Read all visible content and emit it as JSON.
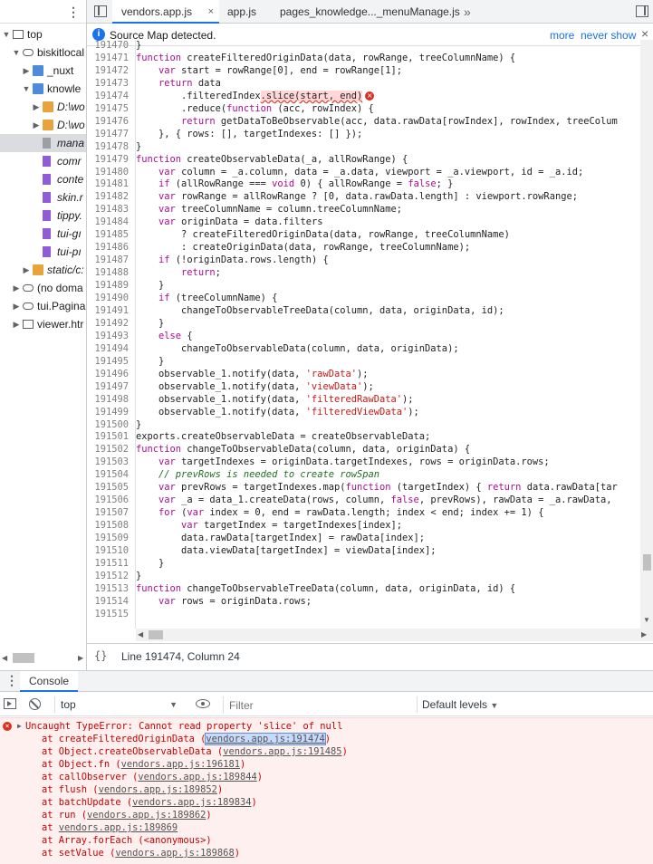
{
  "sidebar": {
    "tree": [
      {
        "label": "top",
        "icon": "page-frame-icon",
        "depth": 0,
        "expanded": true
      },
      {
        "label": "biskitlocal",
        "icon": "cloud-icon",
        "depth": 1,
        "expanded": true
      },
      {
        "label": "_nuxt",
        "icon": "folder-icon",
        "depth": 2,
        "expanded": false
      },
      {
        "label": "knowle",
        "icon": "folder-icon",
        "depth": 2,
        "expanded": true
      },
      {
        "label": "D:\\wo",
        "icon": "folder-orange-icon",
        "depth": 3,
        "expanded": false,
        "italic": true
      },
      {
        "label": "D:\\wo",
        "icon": "folder-orange-icon",
        "depth": 3,
        "expanded": false,
        "italic": true
      },
      {
        "label": "mana",
        "icon": "file-grey-icon",
        "depth": 3,
        "selected": true,
        "italic": true
      },
      {
        "label": "comr",
        "icon": "file-purple-icon",
        "depth": 3,
        "italic": true
      },
      {
        "label": "conte",
        "icon": "file-purple-icon",
        "depth": 3,
        "italic": true
      },
      {
        "label": "skin.r",
        "icon": "file-purple-icon",
        "depth": 3,
        "italic": true
      },
      {
        "label": "tippy.",
        "icon": "file-purple-icon",
        "depth": 3,
        "italic": true
      },
      {
        "label": "tui-gı",
        "icon": "file-purple-icon",
        "depth": 3,
        "italic": true
      },
      {
        "label": "tui-pı",
        "icon": "file-purple-icon",
        "depth": 3,
        "italic": true
      },
      {
        "label": "static/c:",
        "icon": "folder-orange-icon",
        "depth": 2,
        "expanded": false,
        "italic": true
      },
      {
        "label": "(no doma",
        "icon": "cloud-icon",
        "depth": 1,
        "expanded": false
      },
      {
        "label": "tui.Pagina",
        "icon": "cloud-icon",
        "depth": 1,
        "expanded": false
      },
      {
        "label": "viewer.htr",
        "icon": "page-frame-icon",
        "depth": 1,
        "expanded": false
      }
    ]
  },
  "tabs": [
    {
      "label": "vendors.app.js",
      "active": true,
      "closable": true
    },
    {
      "label": "app.js",
      "active": false
    },
    {
      "label": "pages_knowledge..._menuManage.js",
      "active": false
    }
  ],
  "tabs_more": "»",
  "infobar": {
    "text": "Source Map detected.",
    "more": "more",
    "never_show": "never show"
  },
  "code": [
    {
      "n": "191470",
      "t": "}"
    },
    {
      "n": "191471",
      "t": "function createFilteredOriginData(data, rowRange, treeColumnName) {"
    },
    {
      "n": "191472",
      "t": "    var start = rowRange[0], end = rowRange[1];"
    },
    {
      "n": "191473",
      "t": "    return data"
    },
    {
      "n": "191474",
      "t": "        .filteredIndex.slice(start, end)",
      "err": true
    },
    {
      "n": "191475",
      "t": "        .reduce(function (acc, rowIndex) {"
    },
    {
      "n": "191476",
      "t": "        return getDataToBeObservable(acc, data.rawData[rowIndex], rowIndex, treeColum"
    },
    {
      "n": "191477",
      "t": "    }, { rows: [], targetIndexes: [] });"
    },
    {
      "n": "191478",
      "t": "}"
    },
    {
      "n": "191479",
      "t": "function createObservableData(_a, allRowRange) {"
    },
    {
      "n": "191480",
      "t": "    var column = _a.column, data = _a.data, viewport = _a.viewport, id = _a.id;"
    },
    {
      "n": "191481",
      "t": "    if (allRowRange === void 0) { allRowRange = false; }"
    },
    {
      "n": "191482",
      "t": "    var rowRange = allRowRange ? [0, data.rawData.length] : viewport.rowRange;"
    },
    {
      "n": "191483",
      "t": "    var treeColumnName = column.treeColumnName;"
    },
    {
      "n": "191484",
      "t": "    var originData = data.filters"
    },
    {
      "n": "191485",
      "t": "        ? createFilteredOriginData(data, rowRange, treeColumnName)"
    },
    {
      "n": "191486",
      "t": "        : createOriginData(data, rowRange, treeColumnName);"
    },
    {
      "n": "191487",
      "t": "    if (!originData.rows.length) {"
    },
    {
      "n": "191488",
      "t": "        return;"
    },
    {
      "n": "191489",
      "t": "    }"
    },
    {
      "n": "191490",
      "t": "    if (treeColumnName) {"
    },
    {
      "n": "191491",
      "t": "        changeToObservableTreeData(column, data, originData, id);"
    },
    {
      "n": "191492",
      "t": "    }"
    },
    {
      "n": "191493",
      "t": "    else {"
    },
    {
      "n": "191494",
      "t": "        changeToObservableData(column, data, originData);"
    },
    {
      "n": "191495",
      "t": "    }"
    },
    {
      "n": "191496",
      "t": "    observable_1.notify(data, 'rawData');"
    },
    {
      "n": "191497",
      "t": "    observable_1.notify(data, 'viewData');"
    },
    {
      "n": "191498",
      "t": "    observable_1.notify(data, 'filteredRawData');"
    },
    {
      "n": "191499",
      "t": "    observable_1.notify(data, 'filteredViewData');"
    },
    {
      "n": "191500",
      "t": "}"
    },
    {
      "n": "191501",
      "t": "exports.createObservableData = createObservableData;"
    },
    {
      "n": "191502",
      "t": "function changeToObservableData(column, data, originData) {"
    },
    {
      "n": "191503",
      "t": "    var targetIndexes = originData.targetIndexes, rows = originData.rows;"
    },
    {
      "n": "191504",
      "t": "    // prevRows is needed to create rowSpan",
      "comment": true
    },
    {
      "n": "191505",
      "t": "    var prevRows = targetIndexes.map(function (targetIndex) { return data.rawData[tar"
    },
    {
      "n": "191506",
      "t": "    var _a = data_1.createData(rows, column, false, prevRows), rawData = _a.rawData,"
    },
    {
      "n": "191507",
      "t": "    for (var index = 0, end = rawData.length; index < end; index += 1) {"
    },
    {
      "n": "191508",
      "t": "        var targetIndex = targetIndexes[index];"
    },
    {
      "n": "191509",
      "t": "        data.rawData[targetIndex] = rawData[index];"
    },
    {
      "n": "191510",
      "t": "        data.viewData[targetIndex] = viewData[index];"
    },
    {
      "n": "191511",
      "t": "    }"
    },
    {
      "n": "191512",
      "t": "}"
    },
    {
      "n": "191513",
      "t": "function changeToObservableTreeData(column, data, originData, id) {"
    },
    {
      "n": "191514",
      "t": "    var rows = originData.rows;"
    },
    {
      "n": "191515",
      "t": ""
    }
  ],
  "status": {
    "braces": "{}",
    "position": "Line 191474, Column 24"
  },
  "drawer": {
    "tab": "Console",
    "menu_icon": "kebab-menu-icon"
  },
  "console_toolbar": {
    "context": "top",
    "filter_placeholder": "Filter",
    "levels": "Default levels"
  },
  "error": {
    "message": "Uncaught TypeError: Cannot read property 'slice' of null",
    "stack": [
      {
        "pre": "at createFilteredOriginData (",
        "link": "vendors.app.js:191474",
        "post": ")",
        "highlight": true
      },
      {
        "pre": "at Object.createObservableData (",
        "link": "vendors.app.js:191485",
        "post": ")"
      },
      {
        "pre": "at Object.fn (",
        "link": "vendors.app.js:196181",
        "post": ")"
      },
      {
        "pre": "at callObserver (",
        "link": "vendors.app.js:189844",
        "post": ")"
      },
      {
        "pre": "at flush (",
        "link": "vendors.app.js:189852",
        "post": ")"
      },
      {
        "pre": "at batchUpdate (",
        "link": "vendors.app.js:189834",
        "post": ")"
      },
      {
        "pre": "at run (",
        "link": "vendors.app.js:189862",
        "post": ")"
      },
      {
        "pre": "at ",
        "link": "vendors.app.js:189869",
        "post": ""
      },
      {
        "pre": "at Array.forEach (<anonymous>)",
        "link": "",
        "post": ""
      },
      {
        "pre": "at setValue (",
        "link": "vendors.app.js:189868",
        "post": ")"
      }
    ]
  },
  "colors": {
    "accent": "#1a73e8",
    "error": "#d93025",
    "error_bg": "#fff0f0"
  }
}
